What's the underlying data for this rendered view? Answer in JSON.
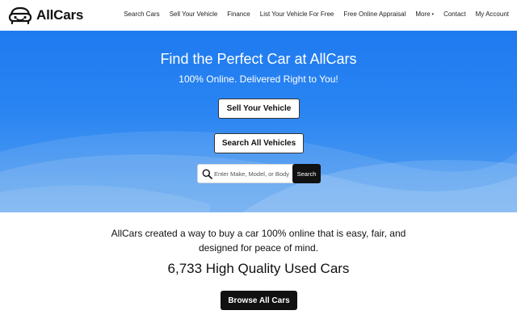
{
  "brand": {
    "name": "AllCars",
    "logo_icon": "car-face-icon"
  },
  "nav": {
    "items": [
      {
        "label": "Search Cars"
      },
      {
        "label": "Sell Your Vehicle"
      },
      {
        "label": "Finance"
      },
      {
        "label": "List Your Vehicle For Free"
      },
      {
        "label": "Free Online Appraisal"
      },
      {
        "label": "More"
      },
      {
        "label": "Contact"
      },
      {
        "label": "My Account"
      }
    ],
    "more_caret": "▾"
  },
  "hero": {
    "title": "Find the Perfect Car at AllCars",
    "subtitle": "100% Online. Delivered Right to You!",
    "sell_button": "Sell Your Vehicle",
    "search_all_button": "Search All Vehicles",
    "search": {
      "placeholder": "Enter Make, Model, or Body Style",
      "button": "Search",
      "icon": "search-icon"
    },
    "colors": {
      "top": "#1e7af0",
      "bottom": "#5aa2ee"
    }
  },
  "intro": {
    "description": "AllCars created a way to buy a car 100% online that is easy, fair, and designed for peace of mind.",
    "inventory_count": "6,733 High Quality Used Cars",
    "browse_button": "Browse All Cars"
  }
}
